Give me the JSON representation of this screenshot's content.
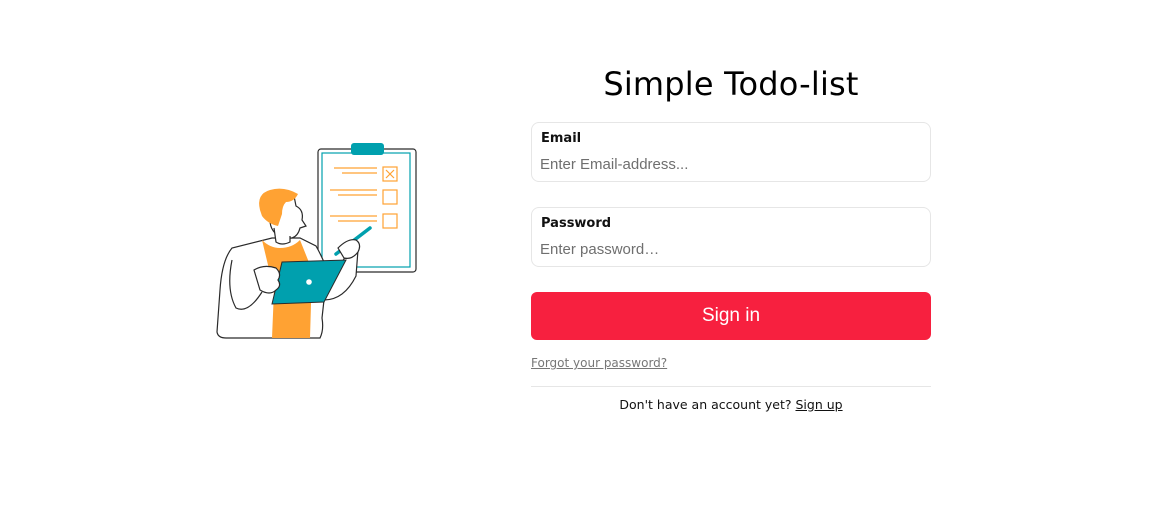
{
  "app": {
    "title": "Simple Todo-list"
  },
  "form": {
    "email": {
      "label": "Email",
      "placeholder": "Enter Email-address...",
      "value": ""
    },
    "password": {
      "label": "Password",
      "placeholder": "Enter password…",
      "value": ""
    },
    "submit_label": "Sign in",
    "forgot_label": "Forgot your password?",
    "signup_prompt": "Don't have an account yet?",
    "signup_link": "Sign up"
  },
  "illustration": {
    "name": "person-with-checklist-illustration"
  },
  "colors": {
    "accent": "#f7203f",
    "teal": "#00a0ae",
    "orange": "#ffa233",
    "border": "#e6e6e6"
  }
}
